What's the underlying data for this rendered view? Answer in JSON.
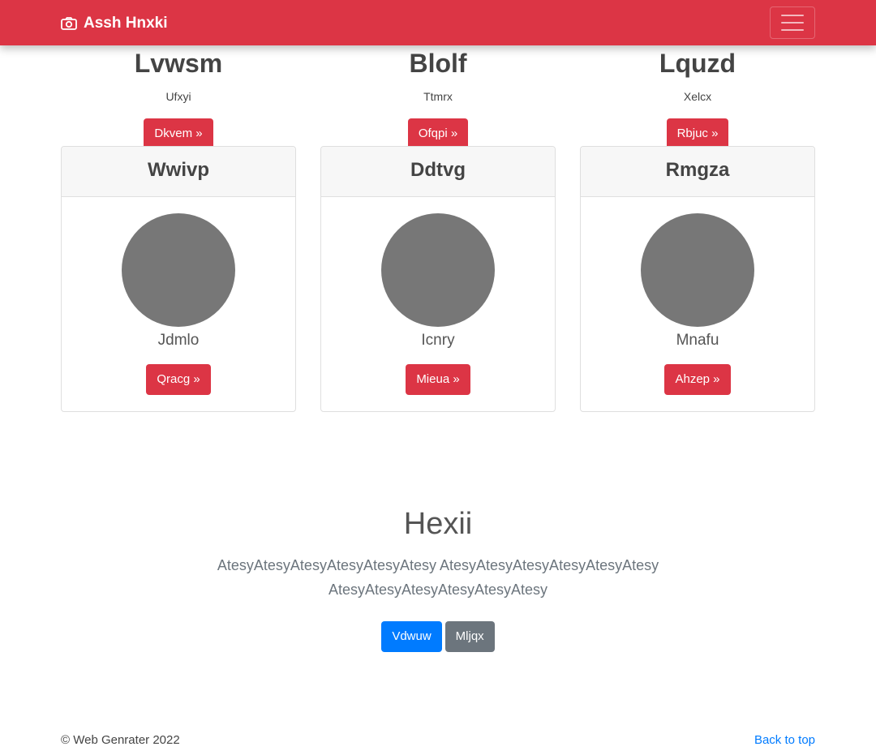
{
  "navbar": {
    "brand": "Assh Hnxki",
    "brand_icon": "camera-icon",
    "toggler_icon": "hamburger-menu-icon",
    "color": "#dc3545"
  },
  "columns": [
    {
      "title": "Lvwsm",
      "subtitle": "Ufxyi",
      "button": "Dkvem »"
    },
    {
      "title": "Blolf",
      "subtitle": "Ttmrx",
      "button": "Ofqpi »"
    },
    {
      "title": "Lquzd",
      "subtitle": "Xelcx",
      "button": "Rbjuc »"
    }
  ],
  "cards": [
    {
      "header": "Wwivp",
      "name": "Jdmlo",
      "button": "Qracg »"
    },
    {
      "header": "Ddtvg",
      "name": "Icnry",
      "button": "Mieua »"
    },
    {
      "header": "Rmgza",
      "name": "Mnafu",
      "button": "Ahzep »"
    }
  ],
  "hero": {
    "title": "Hexii",
    "text": "AtesyAtesyAtesyAtesyAtesyAtesy AtesyAtesyAtesyAtesyAtesyAtesy AtesyAtesyAtesyAtesyAtesyAtesy",
    "primary_button": "Vdwuw",
    "secondary_button": "Mljqx"
  },
  "footer": {
    "copyright": "© Web Genrater 2022",
    "back_to_top": "Back to top"
  }
}
